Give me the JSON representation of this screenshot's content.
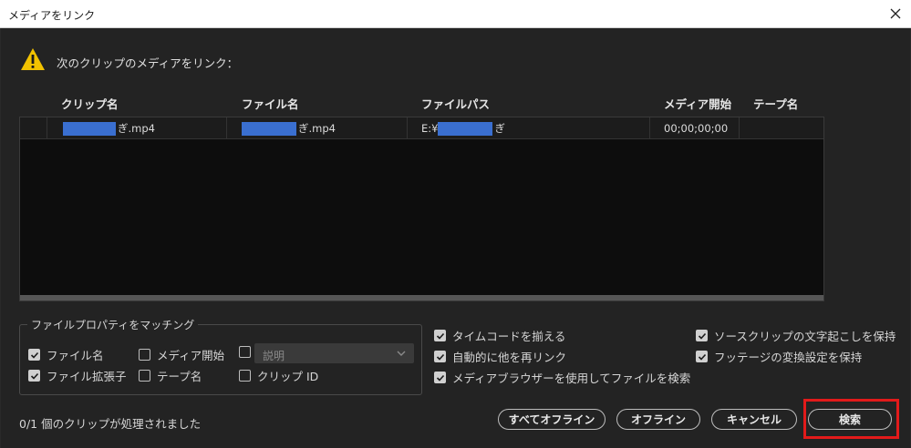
{
  "window": {
    "title": "メディアをリンク"
  },
  "header": {
    "message": "次のクリップのメディアをリンク："
  },
  "table": {
    "columns": [
      "クリップ名",
      "ファイル名",
      "ファイルパス",
      "メディア開始",
      "テープ名"
    ],
    "rows": [
      {
        "clip_suffix": "ぎ.mp4",
        "file_suffix": "ぎ.mp4",
        "path_prefix": "E:¥",
        "path_suffix": "ぎ",
        "media_start": "00;00;00;00",
        "tape": ""
      }
    ]
  },
  "matching": {
    "legend": "ファイルプロパティをマッチング",
    "filename": "ファイル名",
    "media_start": "メディア開始",
    "description": "説明",
    "extension": "ファイル拡張子",
    "tape_name": "テープ名",
    "clip_id": "クリップ ID"
  },
  "options": {
    "align_timecode": "タイムコードを揃える",
    "auto_relink": "自動的に他を再リンク",
    "use_media_browser": "メディアブラウザーを使用してファイルを検索",
    "keep_transcript": "ソースクリップの文字起こしを保持",
    "keep_interpret": "フッテージの変換設定を保持"
  },
  "status": "0/1 個のクリップが処理されました",
  "buttons": {
    "offline_all": "すべてオフライン",
    "offline": "オフライン",
    "cancel": "キャンセル",
    "search": "検索"
  },
  "colors": {
    "accent_highlight": "#e21a1a",
    "warning": "#f2c200",
    "redaction": "#3a6fd0"
  }
}
